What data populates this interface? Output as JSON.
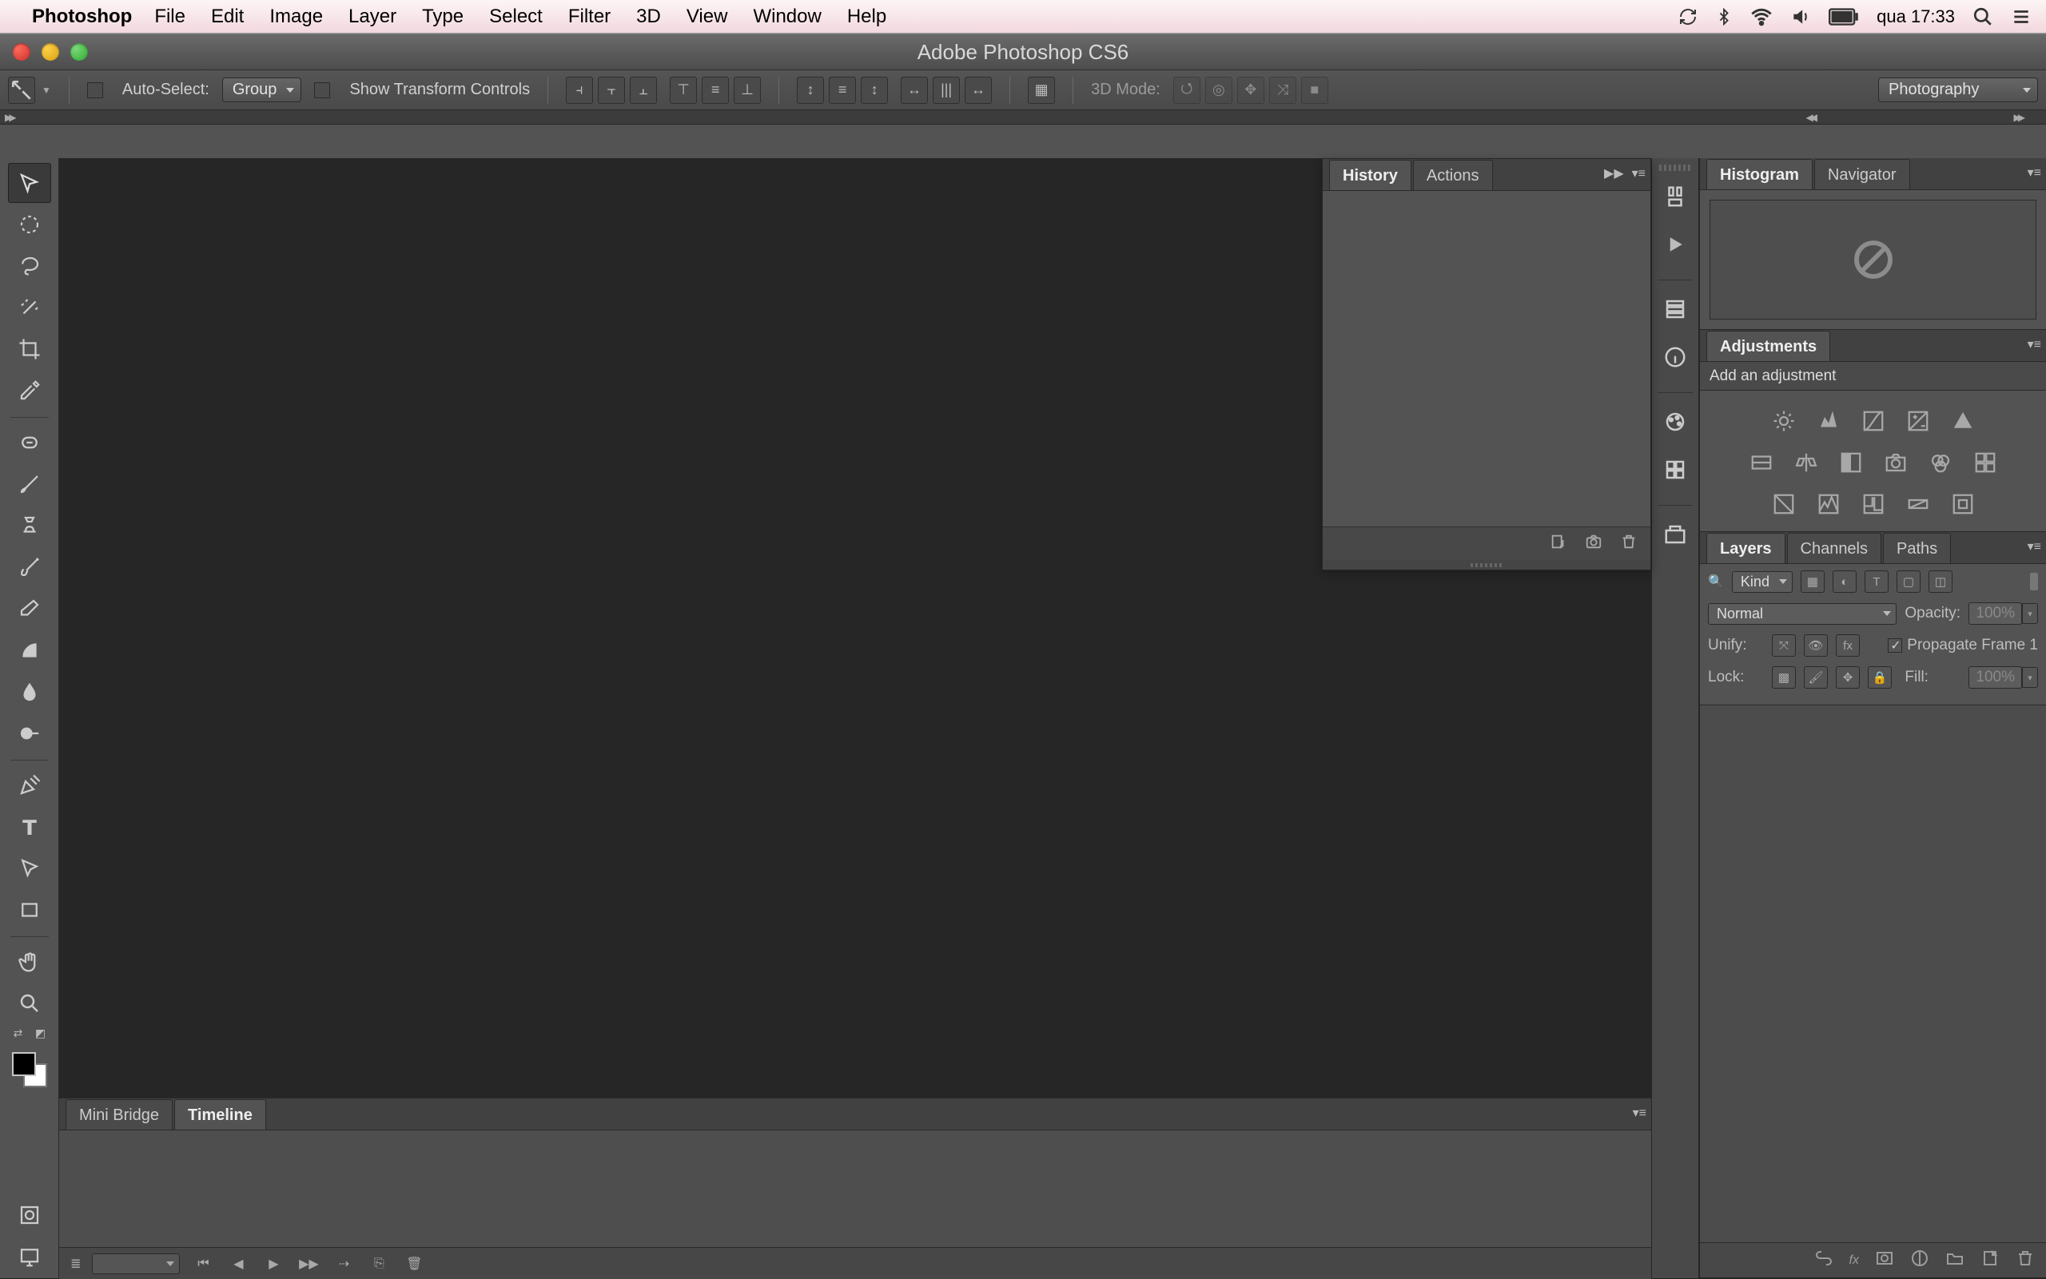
{
  "menubar": {
    "app": "Photoshop",
    "items": [
      "File",
      "Edit",
      "Image",
      "Layer",
      "Type",
      "Select",
      "Filter",
      "3D",
      "View",
      "Window",
      "Help"
    ],
    "clock": "qua 17:33"
  },
  "window_title": "Adobe Photoshop CS6",
  "options_bar": {
    "auto_select": "Auto-Select:",
    "auto_select_mode": "Group",
    "show_transform": "Show Transform Controls",
    "mode_3d": "3D Mode:",
    "workspace": "Photography"
  },
  "tools": [
    "move",
    "marquee",
    "lasso",
    "magic-wand",
    "crop",
    "eyedropper",
    "healing",
    "brush",
    "stamp",
    "history-brush",
    "eraser",
    "gradient",
    "blur",
    "dodge",
    "pen",
    "type",
    "path-select",
    "rectangle",
    "hand",
    "zoom"
  ],
  "dock_icons": [
    "tool-presets",
    "play",
    "layer-comps",
    "info",
    "swatches",
    "grid",
    "adjustments-shortcut"
  ],
  "history_panel": {
    "tabs": [
      "History",
      "Actions"
    ]
  },
  "bottom_panel": {
    "tabs": [
      "Mini Bridge",
      "Timeline"
    ]
  },
  "right": {
    "histogram_tabs": [
      "Histogram",
      "Navigator"
    ],
    "adjustments_tab": "Adjustments",
    "adjustments_hint": "Add an adjustment",
    "adjustments_row1": [
      "brightness",
      "levels",
      "curves",
      "exposure",
      "vibrance"
    ],
    "adjustments_row2": [
      "hue",
      "color-balance",
      "bw",
      "photo-filter",
      "channel-mixer",
      "lookup"
    ],
    "adjustments_row3": [
      "invert",
      "posterize",
      "threshold",
      "gradient-map",
      "selective-color"
    ],
    "layers": {
      "tabs": [
        "Layers",
        "Channels",
        "Paths"
      ],
      "filter_label": "Kind",
      "filter_icons": [
        "image",
        "adjust",
        "type",
        "shape",
        "smart"
      ],
      "blend_mode": "Normal",
      "opacity_label": "Opacity:",
      "opacity_value": "100%",
      "unify_label": "Unify:",
      "propagate_label": "Propagate Frame 1",
      "lock_label": "Lock:",
      "fill_label": "Fill:",
      "fill_value": "100%",
      "footer_icons": [
        "link",
        "fx",
        "mask",
        "adjustment",
        "group",
        "new",
        "trash"
      ]
    }
  }
}
